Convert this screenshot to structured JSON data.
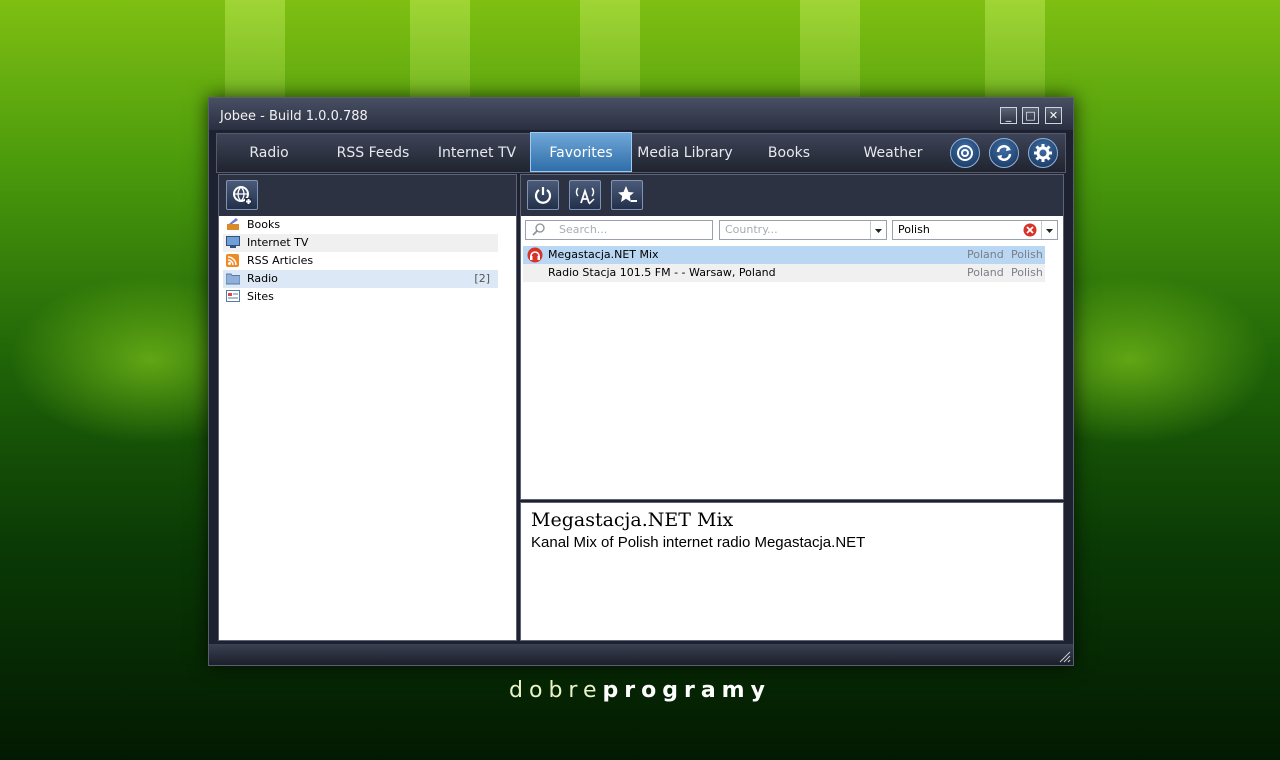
{
  "window": {
    "title": "Jobee - Build 1.0.0.788",
    "controls": [
      "_",
      "□",
      "✕"
    ]
  },
  "tabs": [
    {
      "label": "Radio",
      "active": false
    },
    {
      "label": "RSS Feeds",
      "active": false
    },
    {
      "label": "Internet TV",
      "active": false
    },
    {
      "label": "Favorites",
      "active": true
    },
    {
      "label": "Media Library",
      "active": false
    },
    {
      "label": "Books",
      "active": false
    },
    {
      "label": "Weather",
      "active": false
    }
  ],
  "header_buttons": [
    "help-icon",
    "refresh-icon",
    "settings-icon"
  ],
  "left_panel": {
    "toolbar_icon": "add-globe-icon",
    "tree": [
      {
        "label": "Books",
        "count": "",
        "icon": "books-icon"
      },
      {
        "label": "Internet TV",
        "count": "",
        "icon": "tv-icon"
      },
      {
        "label": "RSS Articles",
        "count": "",
        "icon": "rss-icon"
      },
      {
        "label": "Radio",
        "count": "[2]",
        "icon": "radio-folder-icon"
      },
      {
        "label": "Sites",
        "count": "",
        "icon": "sites-icon"
      }
    ]
  },
  "right_panel": {
    "toolbar_icons": [
      "power-icon",
      "antenna-edit-icon",
      "star-remove-icon"
    ],
    "search_placeholder": "Search...",
    "country_placeholder": "Country...",
    "language_value": "Polish",
    "stations": [
      {
        "name": "Megastacja.NET Mix",
        "country": "Poland",
        "language": "Polish",
        "selected": true
      },
      {
        "name": "Radio Stacja 101.5 FM - - Warsaw, Poland",
        "country": "Poland",
        "language": "Polish",
        "selected": false
      }
    ]
  },
  "description": {
    "title": "Megastacja.NET Mix",
    "text": "Kanal Mix of Polish internet radio Megastacja.NET"
  },
  "watermark": {
    "light": "dobre",
    "bold": "programy"
  },
  "colors": {
    "selection": "#b9d6f2",
    "accent": "#2f6ea9",
    "background": "#1f6308"
  }
}
